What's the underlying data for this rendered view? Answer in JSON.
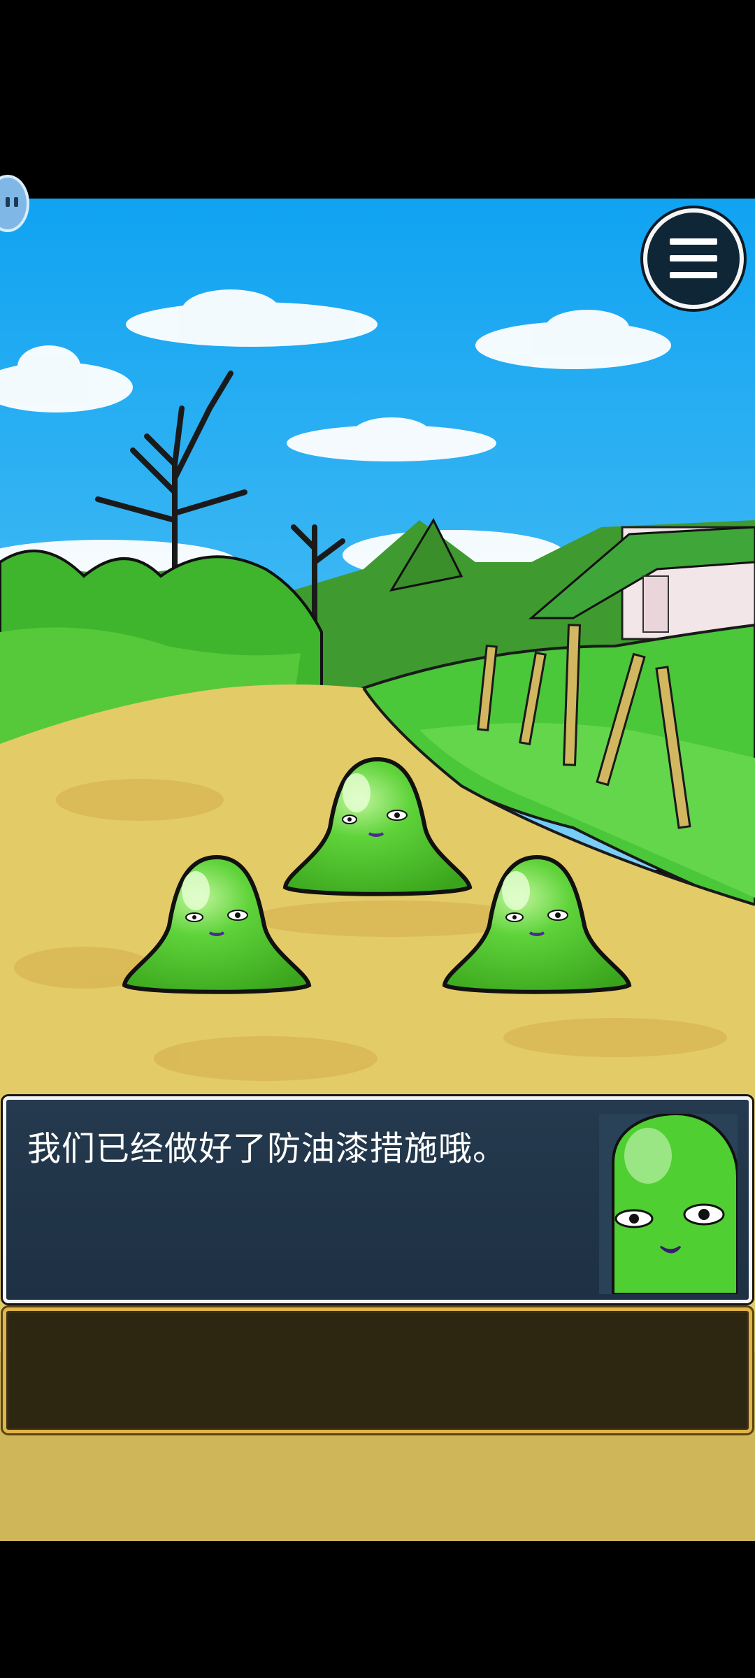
{
  "dialog": {
    "text": "我们已经做好了防油漆措施哦。",
    "speaker_portrait": "green-slime-portrait"
  },
  "menu": {
    "icon": "hamburger-menu-icon"
  },
  "scene": {
    "characters": [
      "green-slime",
      "green-slime",
      "green-slime"
    ],
    "colors": {
      "sky": "#1fa8f0",
      "grass": "#45c52c",
      "dirt": "#e1c863",
      "dialog_bg": "#233649",
      "choice_bg": "#2d2611",
      "choice_border": "#e1b44a"
    }
  }
}
